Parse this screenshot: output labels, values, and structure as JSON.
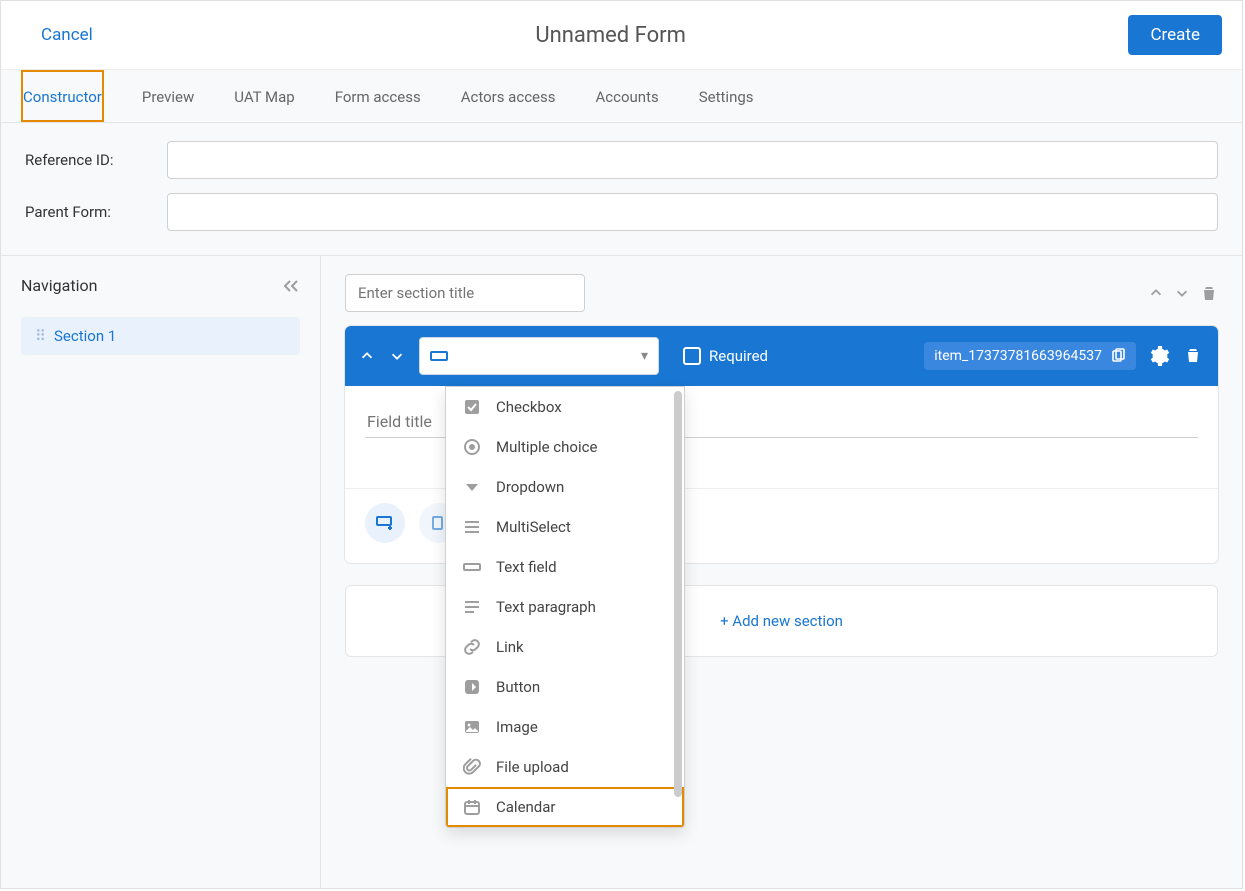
{
  "header": {
    "cancel": "Cancel",
    "title": "Unnamed Form",
    "create": "Create"
  },
  "tabs": [
    "Constructor",
    "Preview",
    "UAT Map",
    "Form access",
    "Actors access",
    "Accounts",
    "Settings"
  ],
  "meta": {
    "ref_label": "Reference ID:",
    "ref_value": "",
    "parent_label": "Parent Form:",
    "parent_value": ""
  },
  "sidebar": {
    "heading": "Navigation",
    "items": [
      {
        "label": "Section 1"
      }
    ]
  },
  "section": {
    "title_placeholder": "Enter section title"
  },
  "field": {
    "required_label": "Required",
    "item_id": "item_17373781663964537",
    "title_placeholder": "Field title"
  },
  "dropdown": [
    {
      "icon": "checkbox",
      "label": "Checkbox"
    },
    {
      "icon": "radio",
      "label": "Multiple choice"
    },
    {
      "icon": "dropdown",
      "label": "Dropdown"
    },
    {
      "icon": "multiselect",
      "label": "MultiSelect"
    },
    {
      "icon": "textfield",
      "label": "Text field"
    },
    {
      "icon": "paragraph",
      "label": "Text paragraph"
    },
    {
      "icon": "link",
      "label": "Link"
    },
    {
      "icon": "button",
      "label": "Button"
    },
    {
      "icon": "image",
      "label": "Image"
    },
    {
      "icon": "file",
      "label": "File upload"
    },
    {
      "icon": "calendar",
      "label": "Calendar"
    }
  ],
  "add_section": "+ Add new section"
}
